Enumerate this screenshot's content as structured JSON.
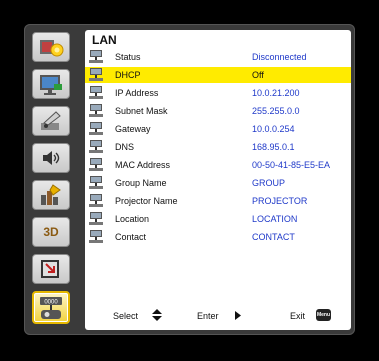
{
  "menu": {
    "title": "LAN",
    "rows": [
      {
        "label": "Status",
        "value": "Disconnected"
      },
      {
        "label": "DHCP",
        "value": "Off"
      },
      {
        "label": "IP Address",
        "value": "10.0.21.200"
      },
      {
        "label": "Subnet Mask",
        "value": "255.255.0.0"
      },
      {
        "label": "Gateway",
        "value": "10.0.0.254"
      },
      {
        "label": "DNS",
        "value": "168.95.0.1"
      },
      {
        "label": "MAC Address",
        "value": "00-50-41-85-E5-EA"
      },
      {
        "label": "Group Name",
        "value": "GROUP"
      },
      {
        "label": "Projector Name",
        "value": "PROJECTOR"
      },
      {
        "label": "Location",
        "value": "LOCATION"
      },
      {
        "label": "Contact",
        "value": "CONTACT"
      }
    ]
  },
  "sidebar": {
    "items": [
      {
        "icon": "image-settings-icon"
      },
      {
        "icon": "display-screen-icon"
      },
      {
        "icon": "setup-icon"
      },
      {
        "icon": "volume-icon"
      },
      {
        "icon": "options-icon"
      },
      {
        "icon": "3d-icon",
        "text": "3D"
      },
      {
        "icon": "lamp-icon"
      },
      {
        "icon": "lan-icon",
        "text": "0000"
      }
    ]
  },
  "footer": {
    "select_label": "Select",
    "enter_label": "Enter",
    "exit_label": "Exit",
    "menu_key": "Menu"
  },
  "colors": {
    "highlight": "#ffeb00",
    "value_text": "#1f39c9"
  }
}
